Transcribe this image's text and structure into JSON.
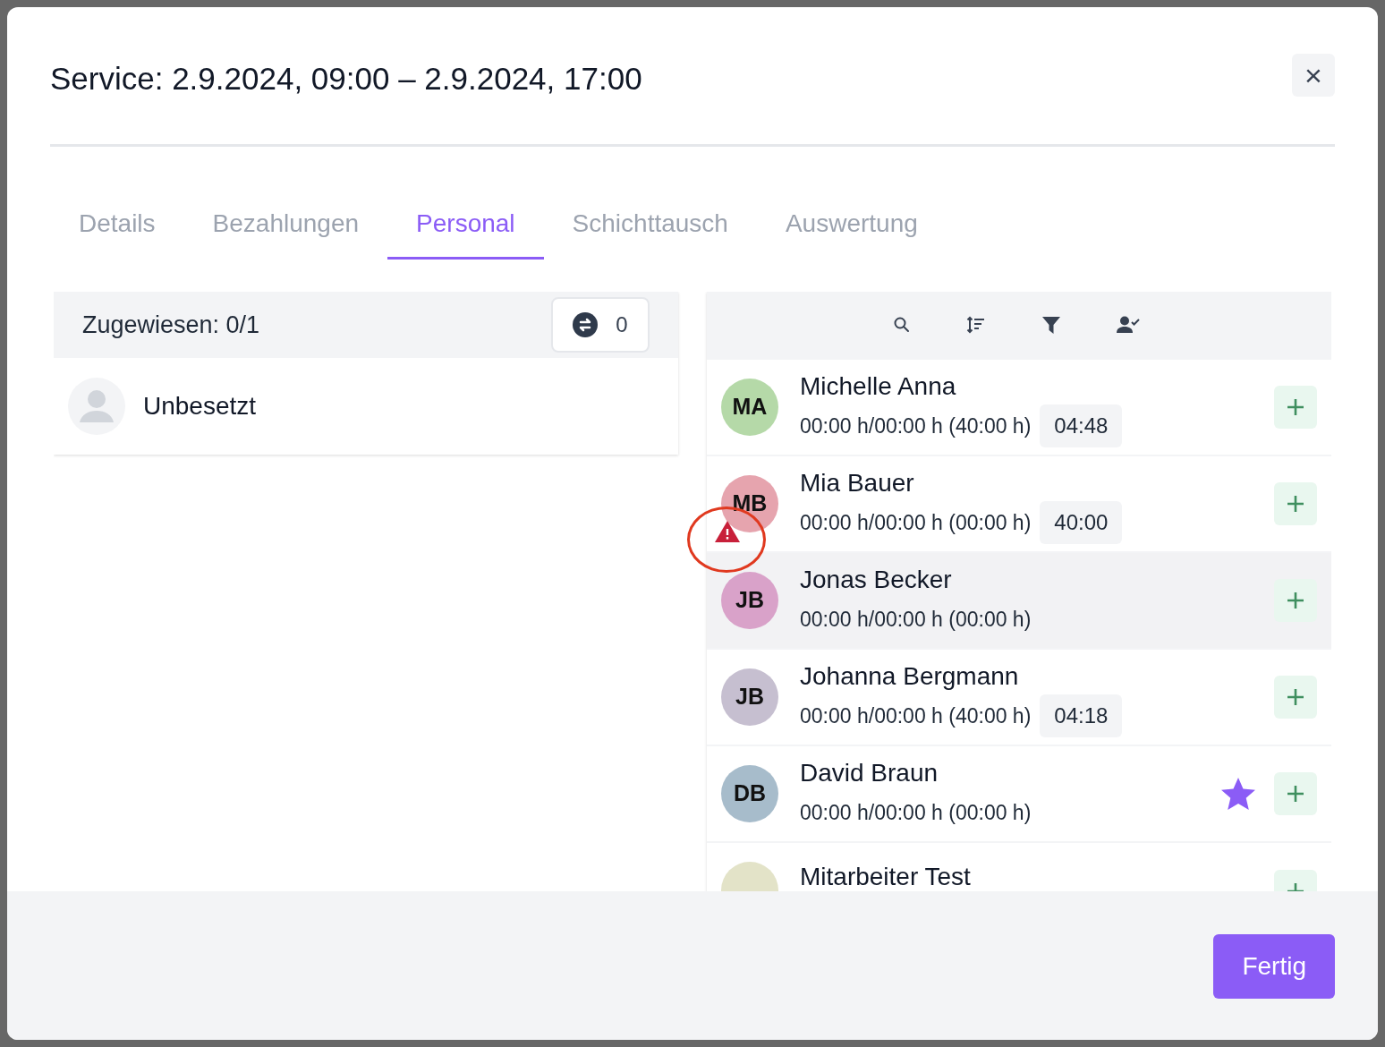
{
  "dialog": {
    "title": "Service: 2.9.2024, 09:00 – 2.9.2024, 17:00",
    "close": "×"
  },
  "tabs": [
    {
      "label": "Details",
      "selected": false
    },
    {
      "label": "Bezahlungen",
      "selected": false
    },
    {
      "label": "Personal",
      "selected": true
    },
    {
      "label": "Schichttausch",
      "selected": false
    },
    {
      "label": "Auswertung",
      "selected": false
    }
  ],
  "assigned": {
    "label": "Zugewiesen: 0/1",
    "swap_count": "0",
    "slots": [
      {
        "label": "Unbesetzt"
      }
    ]
  },
  "employees": [
    {
      "initials": "MA",
      "color": "#b5d9a8",
      "name": "Michelle Anna",
      "hours": "00:00 h/00:00 h (40:00 h)",
      "balance": "04:48",
      "starred": false,
      "warning": false,
      "circled": false,
      "highlighted": false
    },
    {
      "initials": "MB",
      "color": "#e6a4ae",
      "name": "Mia Bauer",
      "hours": "00:00 h/00:00 h (00:00 h)",
      "balance": "40:00",
      "starred": false,
      "warning": true,
      "circled": true,
      "highlighted": false
    },
    {
      "initials": "JB",
      "color": "#d9a2c9",
      "name": "Jonas Becker",
      "hours": "00:00 h/00:00 h (00:00 h)",
      "starred": false,
      "warning": false,
      "circled": false,
      "highlighted": true
    },
    {
      "initials": "JB",
      "color": "#c6bfd0",
      "name": "Johanna Bergmann",
      "hours": "00:00 h/00:00 h (40:00 h)",
      "balance": "04:18",
      "starred": false,
      "warning": false,
      "circled": false,
      "highlighted": false
    },
    {
      "initials": "DB",
      "color": "#a7bccb",
      "name": "David Braun",
      "hours": "00:00 h/00:00 h (00:00 h)",
      "starred": true,
      "warning": false,
      "circled": false,
      "highlighted": false
    },
    {
      "color": "#e3e3c8",
      "name": "Mitarbeiter Test",
      "starred": false,
      "warning": false,
      "circled": false,
      "highlighted": false
    }
  ],
  "footer": {
    "done_button": "Fertig"
  }
}
